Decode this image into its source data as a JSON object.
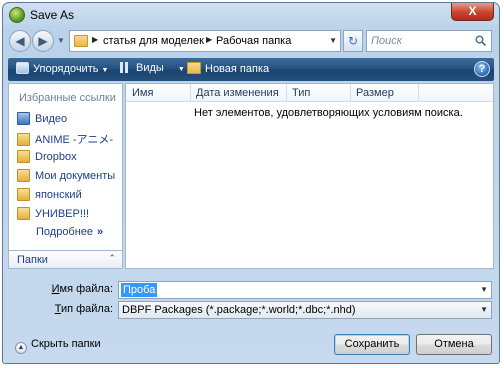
{
  "window": {
    "title": "Save As",
    "close_glyph": "X"
  },
  "address": {
    "breadcrumbs": [
      "статья для моделек",
      "Рабочая папка"
    ],
    "search_placeholder": "Поиск"
  },
  "toolbar": {
    "organize_label": "Упорядочить",
    "views_label": "Виды",
    "new_folder_label": "Новая папка",
    "help_glyph": "?"
  },
  "sidebar": {
    "header": "Избранные ссылки",
    "items": [
      {
        "label": "Видео",
        "icon": "video-folder-icon"
      },
      {
        "label": "ANIME -アニメ-",
        "icon": "folder-icon"
      },
      {
        "label": "Dropbox",
        "icon": "folder-icon"
      },
      {
        "label": "Мои документы",
        "icon": "folder-icon"
      },
      {
        "label": "японский",
        "icon": "folder-icon"
      },
      {
        "label": "УНИВЕР!!!",
        "icon": "folder-icon"
      }
    ],
    "more_label": "Подробнее",
    "folders_label": "Папки"
  },
  "file_list": {
    "columns": [
      "Имя",
      "Дата изменения",
      "Тип",
      "Размер"
    ],
    "empty_message": "Нет элементов, удовлетворяющих условиям поиска."
  },
  "form": {
    "filename_label_u": "И",
    "filename_label_rest": "мя файла:",
    "filename_value": "Проба",
    "filetype_label_u": "Т",
    "filetype_label_rest": "ип файла:",
    "filetype_value": "DBPF Packages (*.package;*.world;*.dbc;*.nhd)"
  },
  "footer": {
    "hide_folders_label": "Скрыть папки",
    "save_label": "Сохранить",
    "cancel_label": "Отмена"
  }
}
